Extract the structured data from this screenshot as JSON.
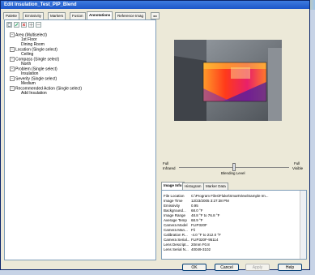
{
  "window": {
    "title": "Edit Insulation_Test_PIP_Blend"
  },
  "tabs": [
    {
      "label": "Palette"
    },
    {
      "label": "Emissivity"
    },
    {
      "label": "Markers"
    },
    {
      "label": "Fusion"
    },
    {
      "label": "Annotations"
    },
    {
      "label": "Reference Imag"
    }
  ],
  "tab_scroll_label": "◂ ▸",
  "toolbar": {
    "icons": [
      "new-annotation-icon",
      "edit-icon",
      "delete-icon",
      "add-item-icon",
      "remove-item-icon"
    ]
  },
  "tree": [
    {
      "label": "Area (Multiselect)",
      "expander": "−"
    },
    {
      "label": "1st Floor",
      "expander": ""
    },
    {
      "label": "Dining Room",
      "expander": ""
    },
    {
      "label": "Location (Single select)",
      "expander": "−"
    },
    {
      "label": "Ceiling",
      "expander": ""
    },
    {
      "label": "Compass (Single select)",
      "expander": "−"
    },
    {
      "label": "North",
      "expander": ""
    },
    {
      "label": "Problem (Single select)",
      "expander": "−"
    },
    {
      "label": "Insulation",
      "expander": ""
    },
    {
      "label": "Severity (Single select)",
      "expander": "−"
    },
    {
      "label": "Medium",
      "expander": ""
    },
    {
      "label": "Recommended Action (Single select)",
      "expander": "−"
    },
    {
      "label": "Add Insulation",
      "expander": ""
    }
  ],
  "blending": {
    "left_top": "Full",
    "left_bottom": "Infrared",
    "right_top": "Full",
    "right_bottom": "Visible",
    "caption": "Blending Level",
    "level": 0.5
  },
  "info_tabs": [
    {
      "label": "Image Info"
    },
    {
      "label": "Histogram"
    },
    {
      "label": "Marker Data"
    }
  ],
  "image_info": [
    {
      "label": "File Location",
      "value": "C:\\Program Files\\Fluke\\SmartView\\Sample Im..."
    },
    {
      "label": "Image Time",
      "value": "12/23/2005 3:27:38 PM"
    },
    {
      "label": "Emissivity",
      "value": "0.95"
    },
    {
      "label": "Background...",
      "value": "68.0 °F"
    },
    {
      "label": "Image Range",
      "value": "48.8 °F to 76.8 °F"
    },
    {
      "label": "Average Temp",
      "value": "68.9 °F"
    },
    {
      "label": "Camera Model",
      "value": "FLIP320F"
    },
    {
      "label": "Camera Man...",
      "value": "Fli"
    },
    {
      "label": "Calibration R...",
      "value": "-4.0 °F to 212.0 °F"
    },
    {
      "label": "Camera Serial...",
      "value": "FLIP320F-95114"
    },
    {
      "label": "Lens Descript...",
      "value": "20mm F0.8"
    },
    {
      "label": "Lens Serial N...",
      "value": "40049-3102"
    }
  ],
  "buttons": {
    "ok": "OK",
    "cancel": "Cancel",
    "apply": "Apply",
    "help": "Help"
  },
  "colors": {
    "title_bar": "#1d56c8",
    "dialog_bg": "#ece9d8",
    "thermal_hot": "#ff3a1a",
    "thermal_warm": "#ff9a2a",
    "thermal_cool": "#4a1fa0"
  }
}
